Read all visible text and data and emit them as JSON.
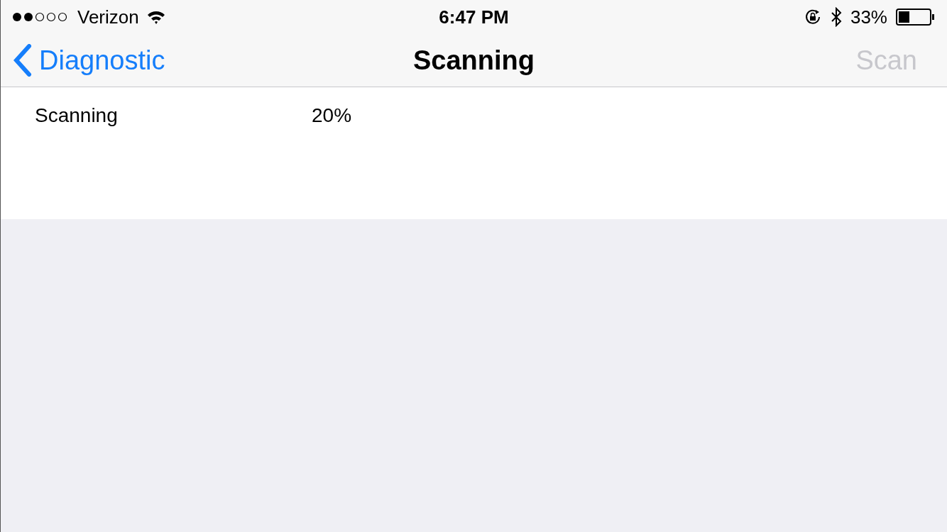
{
  "status_bar": {
    "carrier": "Verizon",
    "time": "6:47 PM",
    "battery": "33%"
  },
  "nav_bar": {
    "back": "Diagnostic",
    "title": "Scanning",
    "action": {
      "label": "Scan",
      "disabled": true
    }
  },
  "rows": [
    {
      "label": "Scanning",
      "value": "20%"
    }
  ]
}
